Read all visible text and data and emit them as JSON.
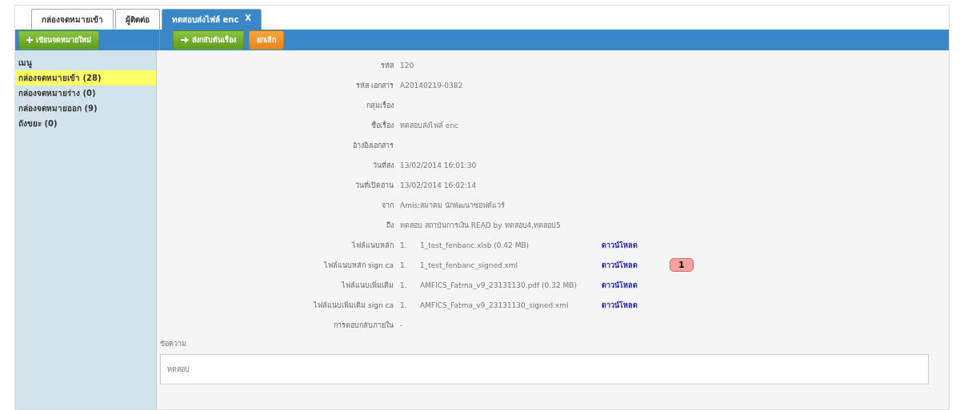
{
  "tabs": [
    {
      "label": "กล่องจดหมายเข้า",
      "selected": false
    },
    {
      "label": "ผู้ติดต่อ",
      "selected": false
    },
    {
      "label": "ทดสอบส่งไฟล์ enc",
      "close": "X",
      "selected": true
    }
  ],
  "sidebar": {
    "new_button": "เขียนจดหมายใหม่",
    "heading": "เมนู",
    "items": [
      {
        "label": "กล่องจดหมายเข้า (28)",
        "selected": true
      },
      {
        "label": "กล่องจดหมายร่าง (0)",
        "selected": false
      },
      {
        "label": "กล่องจดหมายออก (9)",
        "selected": false
      },
      {
        "label": "ถังขยะ (0)",
        "selected": false
      }
    ]
  },
  "toolbar": [
    {
      "label": "ส่งกลับต้นเรื่อง",
      "kind": "forward"
    },
    {
      "label": "ยกเลิก",
      "kind": "cancel"
    }
  ],
  "fields": [
    {
      "label": "รหัส",
      "value": "120"
    },
    {
      "label": "รหัส เอกสาร",
      "value": "A20140219-0382"
    },
    {
      "label": "กลุ่มเรื่อง"
    },
    {
      "label": "ชื่อเรื่อง",
      "value": "ทดสอบส่งไฟล์ enc"
    },
    {
      "label": "อ้างอิงเอกสาร"
    },
    {
      "label": "วันที่ส่ง",
      "value": "13/02/2014 16:01:30"
    },
    {
      "label": "วันที่เปิดอ่าน",
      "value": "13/02/2014 16:02:14"
    },
    {
      "label": "จาก",
      "value": "Amis:สมาคม นักพัฒนาซอฟต์แวร์"
    },
    {
      "label": "ถึง",
      "value": "ทดสอบ สถาบันการเงิน READ by ทดสอบ4,ทดสอบ5"
    }
  ],
  "attachments": [
    {
      "label": "ไฟล์แนบหลัก",
      "number": "1.",
      "file": "1_test_fenbanc.xlsb (0.42 MB)",
      "link": "ดาวน์โหลด"
    },
    {
      "label": "ไฟล์แนบหลัก sign ca",
      "number": "1.",
      "file": "1_test_fenbanc_signed.xml",
      "link": "ดาวน์โหลด",
      "callout": "1"
    },
    {
      "label": "ไฟล์แนบเพิ่มเติม",
      "number": "1.",
      "file": "AMFICS_Fatma_v9_23131130.pdf (0.32 MB)",
      "link": "ดาวน์โหลด"
    },
    {
      "label": "ไฟล์แนบเพิ่มเติม sign ca",
      "number": "1.",
      "file": "AMFICS_Fatma_v9_23131130_signed.xml",
      "link": "ดาวน์โหลด"
    }
  ],
  "reply": {
    "label": "การตอบกลับภายใน",
    "value": "-"
  },
  "message": {
    "label": "ข้อความ",
    "value": "ทดสอบ"
  }
}
